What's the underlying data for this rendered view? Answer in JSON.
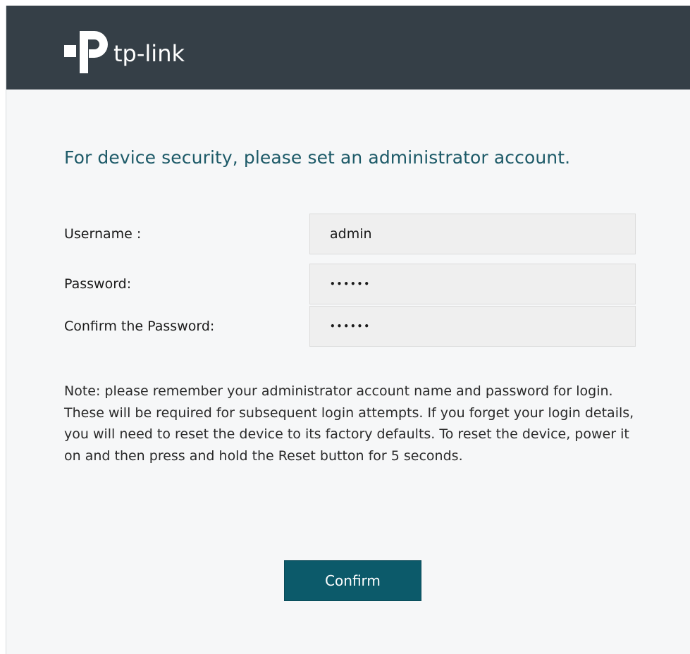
{
  "header": {
    "brand_name": "tp-link",
    "logo_icon": "tp-link-logo-icon",
    "background_color": "#353f47"
  },
  "form": {
    "title": "For device security, please set an administrator account.",
    "username": {
      "label": "Username :",
      "value": "admin"
    },
    "password": {
      "label": "Password:",
      "value": "••••••"
    },
    "confirm_password": {
      "label": "Confirm the Password:",
      "value": "••••••"
    },
    "note": "Note: please remember your administrator account name and password for login. These will be required for subsequent login attempts. If you forget your login details, you will need to reset the device to its factory defaults. To reset the device, power it on and then press and hold the Reset button for 5 seconds.",
    "confirm_label": "Confirm"
  },
  "colors": {
    "accent": "#0c5a6a",
    "title_color": "#1d5a68",
    "page_background": "#f6f7f8"
  }
}
